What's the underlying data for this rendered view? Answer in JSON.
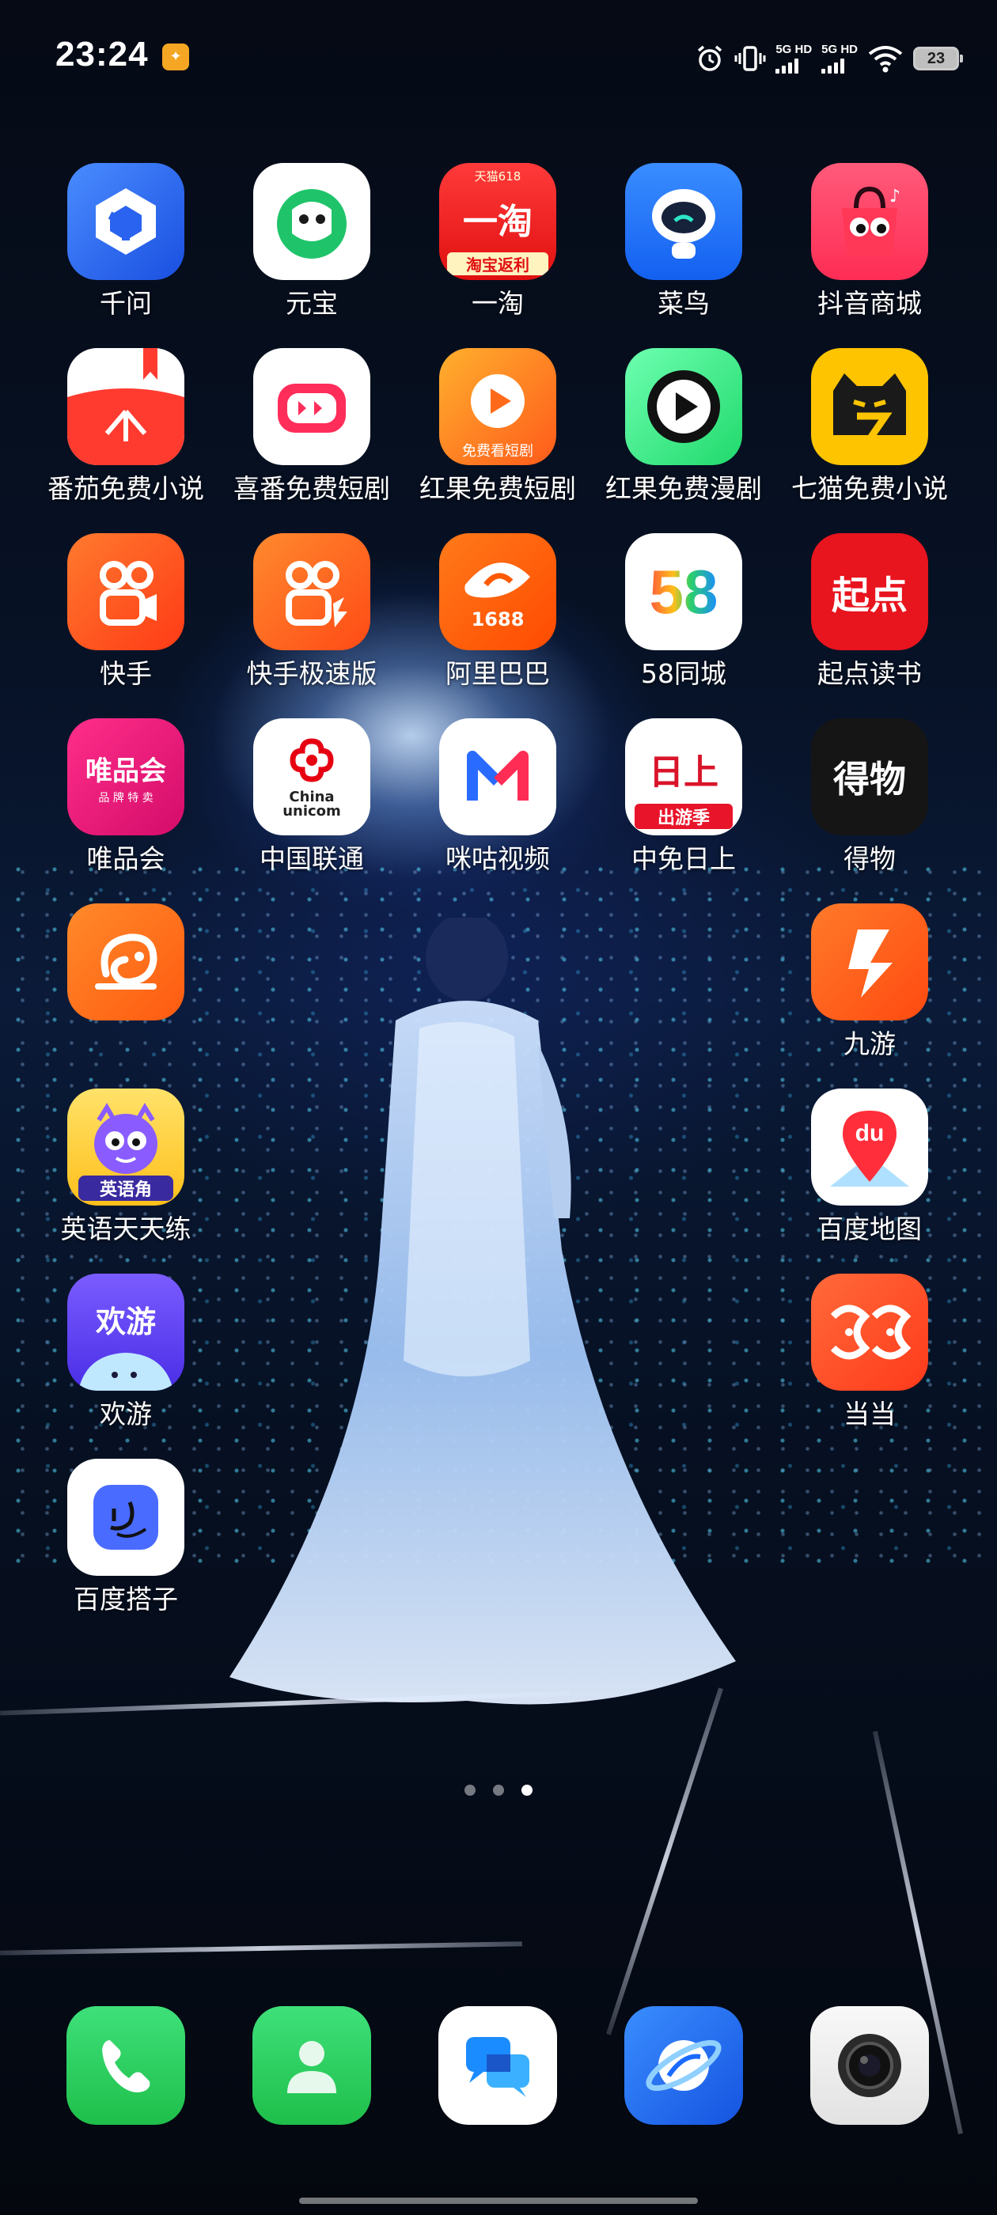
{
  "status_bar": {
    "time": "23:24",
    "sim1": "5G HD",
    "sim2": "5G HD",
    "battery": "23"
  },
  "apps": [
    {
      "label": "千问",
      "icon": "qianwen-icon",
      "bg": "#1a6bff"
    },
    {
      "label": "元宝",
      "icon": "yuanbao-icon",
      "bg": "#ffffff"
    },
    {
      "label": "一淘",
      "icon": "yitao-icon",
      "bg": "#ff2a2a",
      "badge_top": "天猫618",
      "badge_bottom": "淘宝返利",
      "glyph": "一淘"
    },
    {
      "label": "菜鸟",
      "icon": "cainiao-icon",
      "bg": "#1779ff"
    },
    {
      "label": "抖音商城",
      "icon": "douyin-mall-icon",
      "bg": "#ff3d63"
    },
    {
      "label": "番茄免费小说",
      "icon": "tomato-novel-icon",
      "bg": "#ff3b2f"
    },
    {
      "label": "喜番免费短剧",
      "icon": "xifan-icon",
      "bg": "#ffffff"
    },
    {
      "label": "红果免费短剧",
      "icon": "hongguo-icon",
      "bg": "#ff6a1a",
      "badge_bottom": "免费看短剧"
    },
    {
      "label": "红果免费漫剧",
      "icon": "hongguo-manju-icon",
      "bg": "#2de27a"
    },
    {
      "label": "七猫免费小说",
      "icon": "qimao-icon",
      "bg": "#ffc400"
    },
    {
      "label": "快手",
      "icon": "kuaishou-icon",
      "bg": "#ff4d1a"
    },
    {
      "label": "快手极速版",
      "icon": "kuaishou-lite-icon",
      "bg": "#ff5a1a"
    },
    {
      "label": "阿里巴巴",
      "icon": "alibaba-icon",
      "bg": "#ff5a00",
      "glyph": "1688"
    },
    {
      "label": "58同城",
      "icon": "58-icon",
      "bg": "#ffffff",
      "glyph": "58"
    },
    {
      "label": "起点读书",
      "icon": "qidian-icon",
      "bg": "#e8141e",
      "glyph": "起点"
    },
    {
      "label": "唯品会",
      "icon": "vip-icon",
      "bg": "#e6127a",
      "glyph": "唯品会",
      "sub": "品 牌 特 卖"
    },
    {
      "label": "中国联通",
      "icon": "china-unicom-icon",
      "bg": "#ffffff",
      "glyph": "China unicom"
    },
    {
      "label": "咪咕视频",
      "icon": "migu-icon",
      "bg": "#ffffff"
    },
    {
      "label": "中免日上",
      "icon": "cdf-icon",
      "bg": "#ffffff",
      "glyph": "日上",
      "badge_bottom": "出游季"
    },
    {
      "label": "得物",
      "icon": "dewu-icon",
      "bg": "#111111",
      "glyph": "得物"
    },
    {
      "label": "",
      "icon": "uc-browser-icon",
      "bg": "#ff6a12"
    },
    {
      "label": "九游",
      "icon": "jiuyou-icon",
      "bg": "#ff5a1a"
    },
    {
      "label": "英语天天练",
      "icon": "english-practice-icon",
      "bg": "#ffd23a",
      "badge_bottom": "英语角"
    },
    {
      "label": "百度地图",
      "icon": "baidu-map-icon",
      "bg": "#ffffff",
      "glyph": "du"
    },
    {
      "label": "欢游",
      "icon": "huanyou-icon",
      "bg": "#6a4cff",
      "glyph": "欢游"
    },
    {
      "label": "当当",
      "icon": "dangdang-icon",
      "bg": "#ff4a2a"
    },
    {
      "label": "百度搭子",
      "icon": "baidu-dazi-icon",
      "bg": "#ffffff"
    }
  ],
  "page_indicator": {
    "count": 3,
    "active": 2
  },
  "dock": [
    {
      "icon": "phone-icon",
      "bg": "#2bd05c"
    },
    {
      "icon": "contacts-icon",
      "bg": "#2bd05c"
    },
    {
      "icon": "messages-icon",
      "bg": "#ffffff"
    },
    {
      "icon": "browser-icon",
      "bg": "#1e6bff"
    },
    {
      "icon": "camera-icon",
      "bg": "#f2f2f2"
    }
  ]
}
